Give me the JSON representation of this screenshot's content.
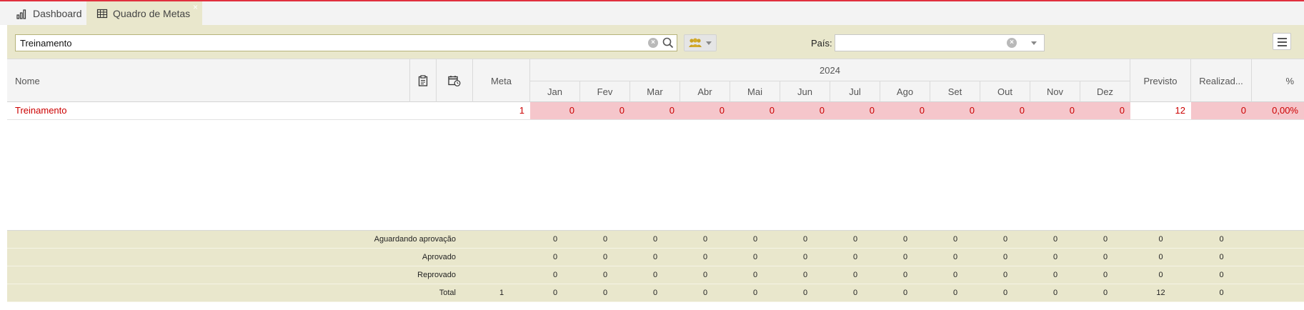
{
  "tabs": [
    {
      "label": "Dashboard",
      "icon": "bar-chart-icon"
    },
    {
      "label": "Quadro de Metas",
      "icon": "table-grid-icon",
      "close": "×"
    }
  ],
  "toolbar": {
    "search_value": "Treinamento",
    "pais_label": "País:",
    "pais_value": ""
  },
  "table": {
    "headers": {
      "nome": "Nome",
      "meta": "Meta",
      "year": "2024",
      "previsto": "Previsto",
      "realizado": "Realizad...",
      "percent": "%"
    },
    "months": [
      "Jan",
      "Fev",
      "Mar",
      "Abr",
      "Mai",
      "Jun",
      "Jul",
      "Ago",
      "Set",
      "Out",
      "Nov",
      "Dez"
    ],
    "rows": [
      {
        "nome": "Treinamento",
        "meta": "1",
        "months": [
          "0",
          "0",
          "0",
          "0",
          "0",
          "0",
          "0",
          "0",
          "0",
          "0",
          "0",
          "0"
        ],
        "previsto": "12",
        "realizado": "0",
        "percent": "0,00%"
      }
    ]
  },
  "summary": [
    {
      "label": "Aguardando aprovação",
      "meta": "",
      "months": [
        "0",
        "0",
        "0",
        "0",
        "0",
        "0",
        "0",
        "0",
        "0",
        "0",
        "0",
        "0"
      ],
      "previsto": "0",
      "realizado": "0"
    },
    {
      "label": "Aprovado",
      "meta": "",
      "months": [
        "0",
        "0",
        "0",
        "0",
        "0",
        "0",
        "0",
        "0",
        "0",
        "0",
        "0",
        "0"
      ],
      "previsto": "0",
      "realizado": "0"
    },
    {
      "label": "Reprovado",
      "meta": "",
      "months": [
        "0",
        "0",
        "0",
        "0",
        "0",
        "0",
        "0",
        "0",
        "0",
        "0",
        "0",
        "0"
      ],
      "previsto": "0",
      "realizado": "0"
    },
    {
      "label": "Total",
      "meta": "1",
      "months": [
        "0",
        "0",
        "0",
        "0",
        "0",
        "0",
        "0",
        "0",
        "0",
        "0",
        "0",
        "0"
      ],
      "previsto": "12",
      "realizado": "0"
    }
  ],
  "colors": {
    "accent": "#e0303e",
    "panel": "#e9e7cc",
    "highlight_row": "#f5c6cb",
    "link_red": "#cc0000"
  }
}
